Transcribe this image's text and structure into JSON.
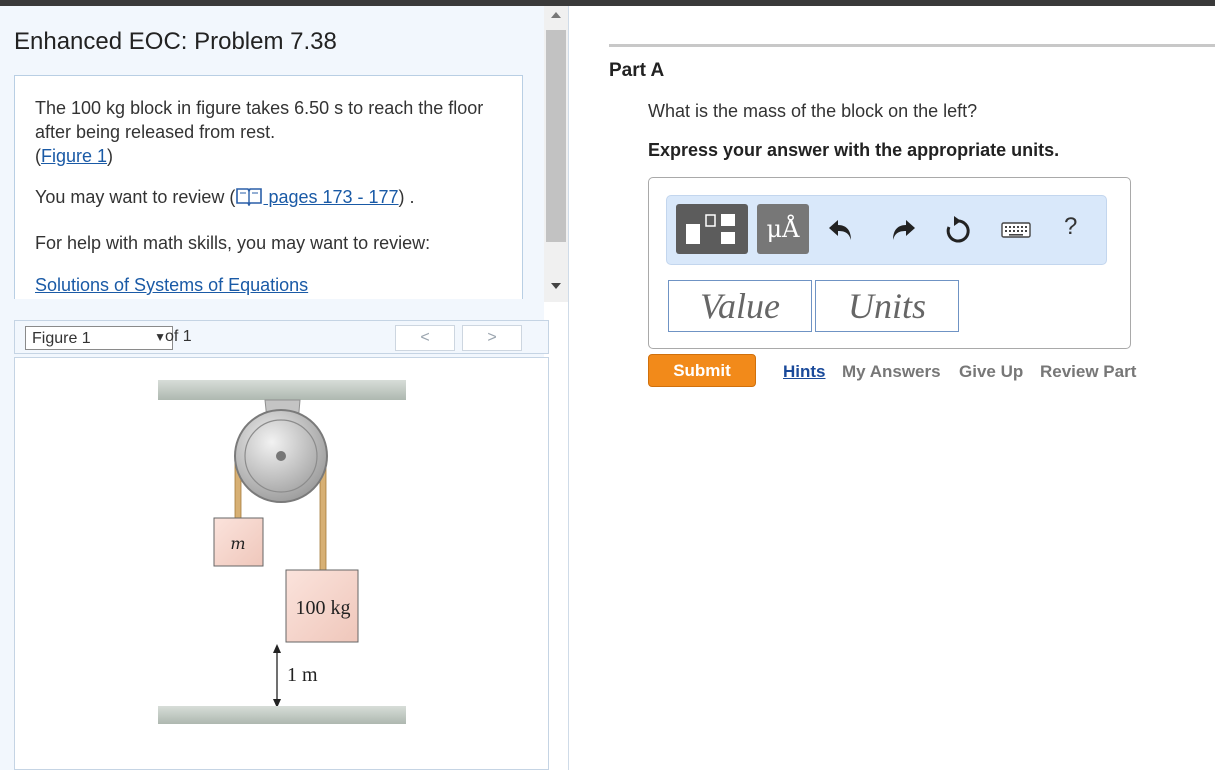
{
  "problem": {
    "title": "Enhanced EOC: Problem 7.38",
    "statement": "The 100 kg block in figure takes 6.50 s to reach the floor after being released from rest.",
    "figure_link": "Figure 1",
    "review_prefix": "You may want to review (",
    "review_link": " pages 173 - 177",
    "review_suffix": ") .",
    "math_help": "For help with math skills, you may want to review:",
    "math_link": "Solutions of Systems of Equations"
  },
  "figure": {
    "selected": "Figure 1",
    "of_label": "of 1",
    "prev_label": "<",
    "next_label": ">",
    "block_left_label": "m",
    "block_right_label": "100 kg",
    "height_label": "1 m"
  },
  "part": {
    "title": "Part A",
    "question": "What is the mass of the block on the left?",
    "instruction": "Express your answer with the appropriate units.",
    "units_tool_label": "μÅ",
    "help_label": "?",
    "value_placeholder": "Value",
    "units_placeholder": "Units"
  },
  "actions": {
    "submit": "Submit",
    "hints": "Hints",
    "my_answers": "My Answers",
    "give_up": "Give Up",
    "review_part": "Review Part"
  },
  "colors": {
    "submit": "#f28a1a",
    "link": "#1a5aa6",
    "toolbar_bg": "#d9e8fa"
  }
}
